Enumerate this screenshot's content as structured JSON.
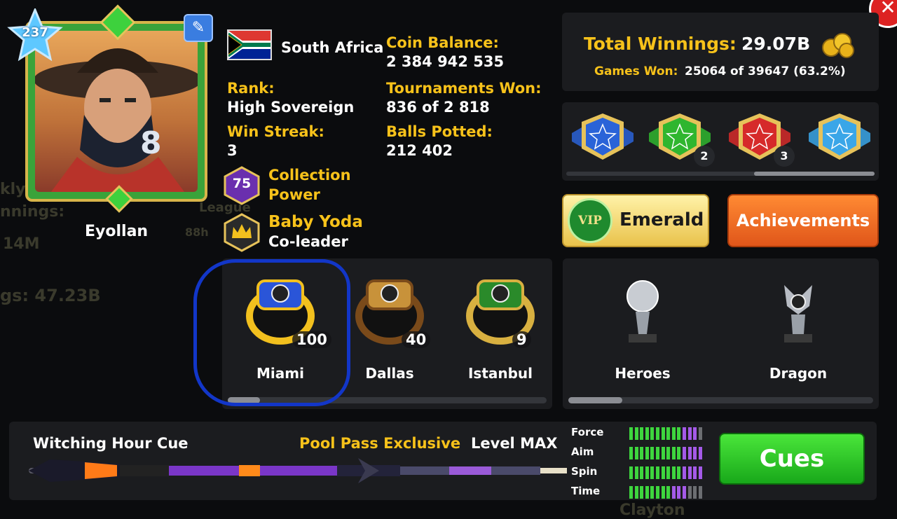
{
  "close_button": {
    "label": "✕"
  },
  "profile": {
    "level": "237",
    "username": "Eyollan",
    "country": "South Africa",
    "rank_label": "Rank:",
    "rank_value": "High Sovereign",
    "win_streak_label": "Win Streak:",
    "win_streak_value": "3",
    "collection_power_value": "75",
    "collection_power_label_1": "Collection",
    "collection_power_label_2": "Power",
    "club_name": "Baby Yoda",
    "club_role": "Co-leader"
  },
  "stats": {
    "coin_balance_label": "Coin Balance:",
    "coin_balance_value": "2 384 942 535",
    "tournaments_won_label": "Tournaments Won:",
    "tournaments_won_value": "836 of 2 818",
    "balls_potted_label": "Balls Potted:",
    "balls_potted_value": "212 402"
  },
  "winnings": {
    "total_label": "Total Winnings:",
    "total_value": "29.07B",
    "games_won_label": "Games Won:",
    "games_won_value": "25064 of 39647 (63.2%)"
  },
  "badges": [
    {
      "color": "#2a63d8",
      "count": ""
    },
    {
      "color": "#2fb62f",
      "count": "2"
    },
    {
      "color": "#d62a2a",
      "count": "3"
    },
    {
      "color": "#3aa6e8",
      "count": ""
    }
  ],
  "buttons": {
    "vip_label": "Emerald",
    "vip_icon_text": "VIP",
    "achievements_label": "Achievements",
    "cues_label": "Cues"
  },
  "rings": [
    {
      "name": "Miami",
      "count": "100"
    },
    {
      "name": "Dallas",
      "count": "40"
    },
    {
      "name": "Istanbul",
      "count": "9"
    }
  ],
  "trophies": [
    {
      "name": "Heroes"
    },
    {
      "name": "Dragon"
    }
  ],
  "cue": {
    "name": "Witching Hour Cue",
    "exclusive_label": "Pool Pass Exclusive",
    "level_label": "Level MAX",
    "stats": [
      {
        "label": "Force",
        "green": 10,
        "purple": 3,
        "gray": 1
      },
      {
        "label": "Aim",
        "green": 10,
        "purple": 4,
        "gray": 0
      },
      {
        "label": "Spin",
        "green": 10,
        "purple": 4,
        "gray": 0
      },
      {
        "label": "Time",
        "green": 8,
        "purple": 3,
        "gray": 3
      }
    ]
  },
  "background_ghost": {
    "text_1": "kly",
    "text_2": "nnings:",
    "text_3": "14M",
    "text_4": "gs: 47.23B",
    "text_5": "League",
    "text_6": "88h",
    "text_7": "Clayton"
  },
  "colors": {
    "gold": "#f7c21a",
    "panel": "#1b1c1f",
    "green_button": "#2bc82b",
    "orange_button": "#f06a22",
    "annotation_blue": "#1236c8"
  }
}
